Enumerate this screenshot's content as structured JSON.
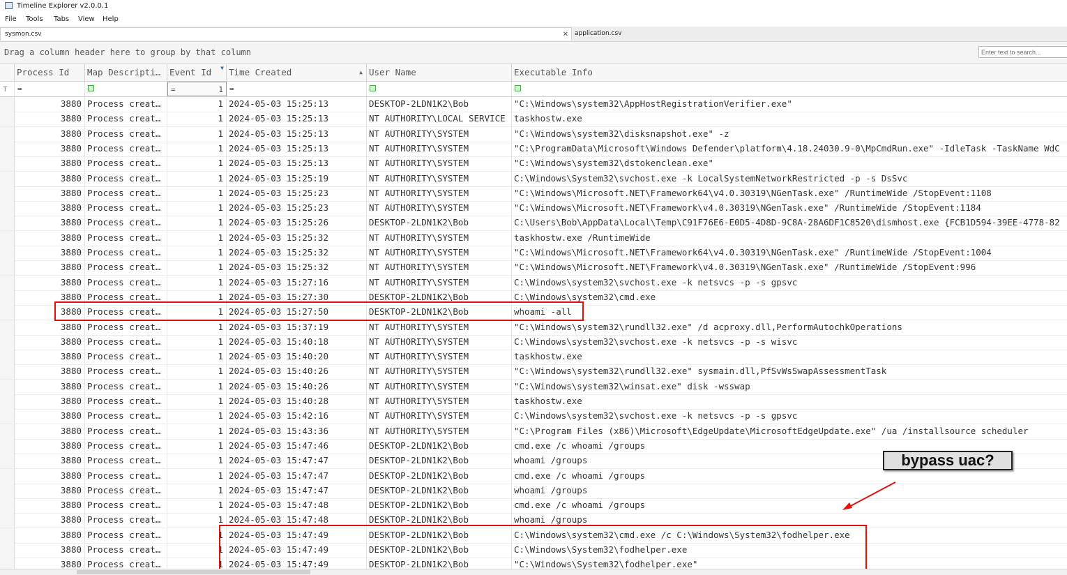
{
  "app": {
    "title": "Timeline Explorer v2.0.0.1",
    "icon": "timeline-app-icon"
  },
  "menu": [
    "File",
    "Tools",
    "Tabs",
    "View",
    "Help"
  ],
  "tabs": [
    {
      "label": "sysmon.csv",
      "active": true,
      "close": "✕"
    },
    {
      "label": "application.csv",
      "active": false
    }
  ],
  "grouping_hint": "Drag a column header here to group by that column",
  "search": {
    "placeholder": "Enter text to search..."
  },
  "columns": [
    "Process Id",
    "Map Descripti…",
    "Event Id",
    "Time Created",
    "User Name",
    "Executable Info"
  ],
  "filter": {
    "process_id": "=",
    "event_id_op": "=",
    "event_id_val": "1",
    "time_created": "="
  },
  "rows": [
    [
      "3880",
      "Process creat…",
      "1",
      "2024-05-03 15:25:13",
      "DESKTOP-2LDN1K2\\Bob",
      "\"C:\\Windows\\system32\\AppHostRegistrationVerifier.exe\""
    ],
    [
      "3880",
      "Process creat…",
      "1",
      "2024-05-03 15:25:13",
      "NT AUTHORITY\\LOCAL SERVICE",
      "taskhostw.exe"
    ],
    [
      "3880",
      "Process creat…",
      "1",
      "2024-05-03 15:25:13",
      "NT AUTHORITY\\SYSTEM",
      "\"C:\\Windows\\system32\\disksnapshot.exe\" -z"
    ],
    [
      "3880",
      "Process creat…",
      "1",
      "2024-05-03 15:25:13",
      "NT AUTHORITY\\SYSTEM",
      "\"C:\\ProgramData\\Microsoft\\Windows Defender\\platform\\4.18.24030.9-0\\MpCmdRun.exe\" -IdleTask -TaskName WdC"
    ],
    [
      "3880",
      "Process creat…",
      "1",
      "2024-05-03 15:25:13",
      "NT AUTHORITY\\SYSTEM",
      "\"C:\\Windows\\system32\\dstokenclean.exe\""
    ],
    [
      "3880",
      "Process creat…",
      "1",
      "2024-05-03 15:25:19",
      "NT AUTHORITY\\SYSTEM",
      "C:\\Windows\\System32\\svchost.exe -k LocalSystemNetworkRestricted -p -s DsSvc"
    ],
    [
      "3880",
      "Process creat…",
      "1",
      "2024-05-03 15:25:23",
      "NT AUTHORITY\\SYSTEM",
      "\"C:\\Windows\\Microsoft.NET\\Framework64\\v4.0.30319\\NGenTask.exe\" /RuntimeWide /StopEvent:1108"
    ],
    [
      "3880",
      "Process creat…",
      "1",
      "2024-05-03 15:25:23",
      "NT AUTHORITY\\SYSTEM",
      "\"C:\\Windows\\Microsoft.NET\\Framework\\v4.0.30319\\NGenTask.exe\" /RuntimeWide /StopEvent:1184"
    ],
    [
      "3880",
      "Process creat…",
      "1",
      "2024-05-03 15:25:26",
      "DESKTOP-2LDN1K2\\Bob",
      "C:\\Users\\Bob\\AppData\\Local\\Temp\\C91F76E6-E0D5-4D8D-9C8A-28A6DF1C8520\\dismhost.exe {FCB1D594-39EE-4778-82"
    ],
    [
      "3880",
      "Process creat…",
      "1",
      "2024-05-03 15:25:32",
      "NT AUTHORITY\\SYSTEM",
      "taskhostw.exe /RuntimeWide"
    ],
    [
      "3880",
      "Process creat…",
      "1",
      "2024-05-03 15:25:32",
      "NT AUTHORITY\\SYSTEM",
      "\"C:\\Windows\\Microsoft.NET\\Framework64\\v4.0.30319\\NGenTask.exe\" /RuntimeWide /StopEvent:1004"
    ],
    [
      "3880",
      "Process creat…",
      "1",
      "2024-05-03 15:25:32",
      "NT AUTHORITY\\SYSTEM",
      "\"C:\\Windows\\Microsoft.NET\\Framework\\v4.0.30319\\NGenTask.exe\" /RuntimeWide /StopEvent:996"
    ],
    [
      "3880",
      "Process creat…",
      "1",
      "2024-05-03 15:27:16",
      "NT AUTHORITY\\SYSTEM",
      "C:\\Windows\\system32\\svchost.exe -k netsvcs -p -s gpsvc"
    ],
    [
      "3880",
      "Process creat…",
      "1",
      "2024-05-03 15:27:30",
      "DESKTOP-2LDN1K2\\Bob",
      "C:\\Windows\\system32\\cmd.exe"
    ],
    [
      "3880",
      "Process creat…",
      "1",
      "2024-05-03 15:27:50",
      "DESKTOP-2LDN1K2\\Bob",
      "whoami  -all"
    ],
    [
      "3880",
      "Process creat…",
      "1",
      "2024-05-03 15:37:19",
      "NT AUTHORITY\\SYSTEM",
      "\"C:\\Windows\\system32\\rundll32.exe\" /d acproxy.dll,PerformAutochkOperations"
    ],
    [
      "3880",
      "Process creat…",
      "1",
      "2024-05-03 15:40:18",
      "NT AUTHORITY\\SYSTEM",
      "C:\\Windows\\system32\\svchost.exe -k netsvcs -p -s wisvc"
    ],
    [
      "3880",
      "Process creat…",
      "1",
      "2024-05-03 15:40:20",
      "NT AUTHORITY\\SYSTEM",
      "taskhostw.exe"
    ],
    [
      "3880",
      "Process creat…",
      "1",
      "2024-05-03 15:40:26",
      "NT AUTHORITY\\SYSTEM",
      "\"C:\\Windows\\system32\\rundll32.exe\" sysmain.dll,PfSvWsSwapAssessmentTask"
    ],
    [
      "3880",
      "Process creat…",
      "1",
      "2024-05-03 15:40:26",
      "NT AUTHORITY\\SYSTEM",
      "\"C:\\Windows\\system32\\winsat.exe\" disk -wsswap"
    ],
    [
      "3880",
      "Process creat…",
      "1",
      "2024-05-03 15:40:28",
      "NT AUTHORITY\\SYSTEM",
      "taskhostw.exe"
    ],
    [
      "3880",
      "Process creat…",
      "1",
      "2024-05-03 15:42:16",
      "NT AUTHORITY\\SYSTEM",
      "C:\\Windows\\system32\\svchost.exe -k netsvcs -p -s gpsvc"
    ],
    [
      "3880",
      "Process creat…",
      "1",
      "2024-05-03 15:43:36",
      "NT AUTHORITY\\SYSTEM",
      "\"C:\\Program Files (x86)\\Microsoft\\EdgeUpdate\\MicrosoftEdgeUpdate.exe\" /ua /installsource scheduler"
    ],
    [
      "3880",
      "Process creat…",
      "1",
      "2024-05-03 15:47:46",
      "DESKTOP-2LDN1K2\\Bob",
      "cmd.exe /c whoami /groups"
    ],
    [
      "3880",
      "Process creat…",
      "1",
      "2024-05-03 15:47:47",
      "DESKTOP-2LDN1K2\\Bob",
      "whoami  /groups"
    ],
    [
      "3880",
      "Process creat…",
      "1",
      "2024-05-03 15:47:47",
      "DESKTOP-2LDN1K2\\Bob",
      "cmd.exe /c whoami /groups"
    ],
    [
      "3880",
      "Process creat…",
      "1",
      "2024-05-03 15:47:47",
      "DESKTOP-2LDN1K2\\Bob",
      "whoami  /groups"
    ],
    [
      "3880",
      "Process creat…",
      "1",
      "2024-05-03 15:47:48",
      "DESKTOP-2LDN1K2\\Bob",
      "cmd.exe /c whoami /groups"
    ],
    [
      "3880",
      "Process creat…",
      "1",
      "2024-05-03 15:47:48",
      "DESKTOP-2LDN1K2\\Bob",
      "whoami  /groups"
    ],
    [
      "3880",
      "Process creat…",
      "1",
      "2024-05-03 15:47:49",
      "DESKTOP-2LDN1K2\\Bob",
      "C:\\Windows\\system32\\cmd.exe /c C:\\Windows\\System32\\fodhelper.exe"
    ],
    [
      "3880",
      "Process creat…",
      "1",
      "2024-05-03 15:47:49",
      "DESKTOP-2LDN1K2\\Bob",
      "C:\\Windows\\System32\\fodhelper.exe"
    ],
    [
      "3880",
      "Process creat…",
      "1",
      "2024-05-03 15:47:49",
      "DESKTOP-2LDN1K2\\Bob",
      "\"C:\\Windows\\System32\\fodhelper.exe\""
    ]
  ],
  "annotation": {
    "label": "bypass uac?",
    "color": "#e01010"
  }
}
